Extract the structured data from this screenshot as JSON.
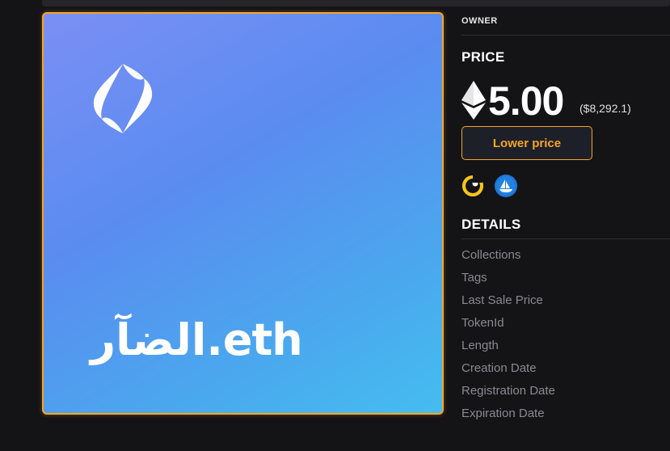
{
  "nft": {
    "name": "الضآر.eth",
    "gradient_start": "#7b8ff5",
    "gradient_end": "#45bdf0",
    "logo_icon": "ens-logo-icon"
  },
  "sidebar": {
    "owner_label": "OWNER",
    "price_title": "PRICE",
    "price": {
      "currency_icon": "eth-icon",
      "value": "5.00",
      "usd": "($8,292.1)"
    },
    "lower_price_button": "Lower price",
    "marketplaces": [
      {
        "icon": "rarible-marketplace-icon",
        "color": "#f5c518"
      },
      {
        "icon": "opensea-marketplace-icon",
        "color": "#2081e2"
      }
    ],
    "details_title": "DETAILS",
    "details": [
      "Collections",
      "Tags",
      "Last Sale Price",
      "TokenId",
      "Length",
      "Creation Date",
      "Registration Date",
      "Expiration Date"
    ]
  },
  "colors": {
    "accent": "#f5a623",
    "background": "#141316",
    "muted_text": "#8a8a92"
  }
}
